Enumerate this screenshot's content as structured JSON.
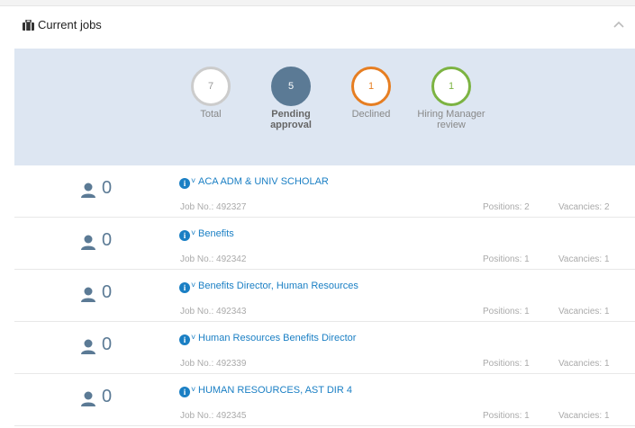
{
  "panel": {
    "title": "Current jobs"
  },
  "stats": {
    "total": {
      "value": "7",
      "label": "Total"
    },
    "pending": {
      "value": "5",
      "label_line1": "Pending",
      "label_line2": "approval"
    },
    "declined": {
      "value": "1",
      "label": "Declined"
    },
    "hiring_manager": {
      "value": "1",
      "label_line1": "Hiring Manager",
      "label_line2": "review"
    }
  },
  "colors": {
    "link": "#1a7fc4",
    "pending": "#5b7a95",
    "declined": "#e67e22",
    "hiring_manager": "#7cb342",
    "stats_background": "#dde6f2"
  },
  "jobs": [
    {
      "count": "0",
      "title": "ACA ADM & UNIV SCHOLAR",
      "job_no": "Job No.: 492327",
      "positions": "Positions: 2",
      "vacancies": "Vacancies: 2"
    },
    {
      "count": "0",
      "title": "Benefits",
      "job_no": "Job No.: 492342",
      "positions": "Positions: 1",
      "vacancies": "Vacancies: 1"
    },
    {
      "count": "0",
      "title": "Benefits Director, Human Resources",
      "job_no": "Job No.: 492343",
      "positions": "Positions: 1",
      "vacancies": "Vacancies: 1"
    },
    {
      "count": "0",
      "title": "Human Resources Benefits Director",
      "job_no": "Job No.: 492339",
      "positions": "Positions: 1",
      "vacancies": "Vacancies: 1"
    },
    {
      "count": "0",
      "title": "HUMAN RESOURCES, AST DIR 4",
      "job_no": "Job No.: 492345",
      "positions": "Positions: 1",
      "vacancies": "Vacancies: 1"
    }
  ],
  "icons": {
    "header": "briefcase-icon",
    "collapse": "chevron-up-icon",
    "row_person": "person-icon",
    "row_info": "info-icon",
    "row_expand": "chevron-down-icon"
  }
}
